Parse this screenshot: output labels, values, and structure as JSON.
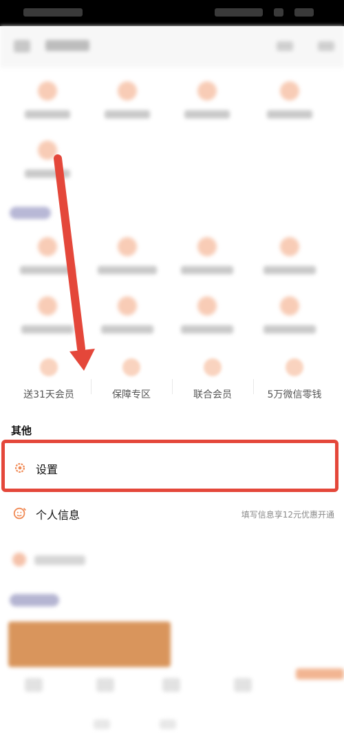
{
  "colors": {
    "accent": "#e4473a",
    "orange": "#f08a55"
  },
  "row4": {
    "items": [
      {
        "label": "送31天会员"
      },
      {
        "label": "保障专区"
      },
      {
        "label": "联合会员"
      },
      {
        "label": "5万微信零钱"
      }
    ]
  },
  "other_section": {
    "title": "其他",
    "settings": {
      "label": "设置",
      "icon": "gear-icon"
    },
    "profile": {
      "label": "个人信息",
      "promo": "填写信息享12元优惠开通",
      "icon": "smile-edit-icon"
    }
  }
}
